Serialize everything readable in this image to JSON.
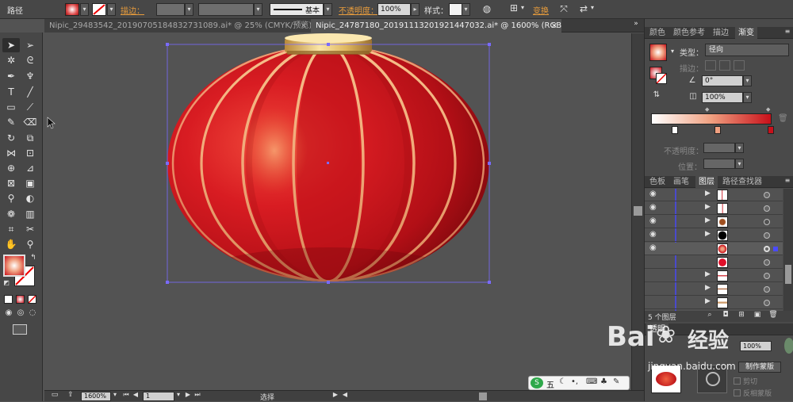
{
  "control_bar": {
    "mode_label": "路径",
    "stroke_label": "描边：",
    "stroke_profile": "基本",
    "opacity_label": "不透明度：",
    "opacity_value": "100%",
    "style_label": "样式：",
    "transform_label": "变换"
  },
  "tabs": [
    {
      "label": "Nipic_29483542_20190705184832731089.ai* @ 25% (CMYK/预览)",
      "close": "×"
    },
    {
      "label": "Nipic_24787180_20191113201921447032.ai* @ 1600% (RGB/预览)",
      "close": "×"
    }
  ],
  "tools_icons": [
    "selection-tool",
    "direct-selection-tool",
    "magic-wand-tool",
    "lasso-tool",
    "pen-tool",
    "curvature-tool",
    "type-tool",
    "line-tool",
    "rectangle-tool",
    "paintbrush-tool",
    "pencil-tool",
    "eraser-tool",
    "rotate-tool",
    "scale-tool",
    "width-tool",
    "free-transform-tool",
    "shape-builder-tool",
    "perspective-grid-tool",
    "mesh-tool",
    "gradient-tool",
    "eyedropper-tool",
    "blend-tool",
    "symbol-sprayer-tool",
    "column-graph-tool",
    "artboard-tool",
    "slice-tool",
    "hand-tool",
    "zoom-tool"
  ],
  "gradient_panel": {
    "tabs": [
      "颜色",
      "颜色参考",
      "描边",
      "渐变"
    ],
    "type_label": "类型：",
    "type_value": "径向",
    "stroke_label": "描边：",
    "angle_value": "0°",
    "aspect_value": "100%",
    "opacity_label": "不透明度：",
    "location_label": "位置：",
    "colors": {
      "start": "#ffffff",
      "mid": "#f0a080",
      "end": "#c8101a"
    }
  },
  "layers_panel": {
    "tabs": [
      "色板",
      "画笔",
      "图层",
      "路径查找器"
    ],
    "count_label": "5 个图层",
    "rows": 9
  },
  "transparency_panel": {
    "title": "透明",
    "opacity_value": "100%",
    "make_mask_button": "制作蒙版",
    "clip_label": "剪切",
    "invert_label": "反相蒙版"
  },
  "status_bar": {
    "zoom": "1600%",
    "artboard": "1",
    "tool_status": "选择"
  },
  "ime_bar": {
    "label": "五"
  },
  "watermark": {
    "brand_latin": "Bai",
    "brand_cn": "经验",
    "url": "jingyan.baidu.com"
  },
  "colors": {
    "lantern_red": "#c8141c",
    "lantern_dark": "#8a0a10",
    "gold": "#e8c070"
  }
}
